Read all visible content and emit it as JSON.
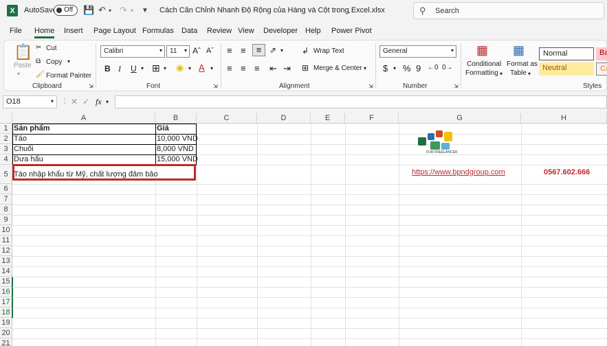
{
  "titlebar": {
    "app_logo": "X",
    "autosave_label": "AutoSave",
    "autosave_state": "Off",
    "file_title": "Cách Căn Chỉnh Nhanh Độ Rộng của Hàng và Cột trong Excel.xlsx",
    "search_placeholder": "Search"
  },
  "tabs": [
    "File",
    "Home",
    "Insert",
    "Page Layout",
    "Formulas",
    "Data",
    "Review",
    "View",
    "Developer",
    "Help",
    "Power Pivot"
  ],
  "active_tab": "Home",
  "ribbon": {
    "clipboard": {
      "label": "Clipboard",
      "paste": "Paste",
      "cut": "Cut",
      "copy": "Copy",
      "format_painter": "Format Painter"
    },
    "font": {
      "label": "Font",
      "font_name": "Calibri",
      "font_size": "11"
    },
    "alignment": {
      "label": "Alignment",
      "wrap_text": "Wrap Text",
      "merge_center": "Merge & Center"
    },
    "number": {
      "label": "Number",
      "format": "General"
    },
    "styles": {
      "label": "Styles",
      "conditional": "Conditional",
      "formatting": "Formatting",
      "format_as": "Format as",
      "table": "Table",
      "normal": "Normal",
      "neutral": "Neutral",
      "bad": "Bad",
      "calc": "Cal"
    }
  },
  "formula_bar": {
    "name_box": "O18",
    "fx": "fx"
  },
  "columns": [
    "A",
    "B",
    "C",
    "D",
    "E",
    "F",
    "G",
    "H"
  ],
  "rows": [
    "1",
    "2",
    "3",
    "4",
    "5",
    "6",
    "7",
    "8",
    "9",
    "10",
    "11",
    "12",
    "13",
    "14",
    "15",
    "16",
    "17",
    "18",
    "19",
    "20",
    "21"
  ],
  "cells": {
    "A1": "Sản phẩm",
    "B1": "Giá",
    "A2": "Táo",
    "B2": "10,000 VND",
    "A3": "Chuối",
    "B3": "8,000 VND",
    "A4": "Dưa hấu",
    "B4": "15,000 VND",
    "A5": "Táo nhập khẩu từ Mỹ, chất lượng đảm bảo",
    "G5": "https://www.bpndgroup.com",
    "H5": "0567.602.666"
  },
  "logo_text": "FOR FREELANCER",
  "colors": {
    "accent": "#1d6f42",
    "highlight": "#c0282d"
  }
}
